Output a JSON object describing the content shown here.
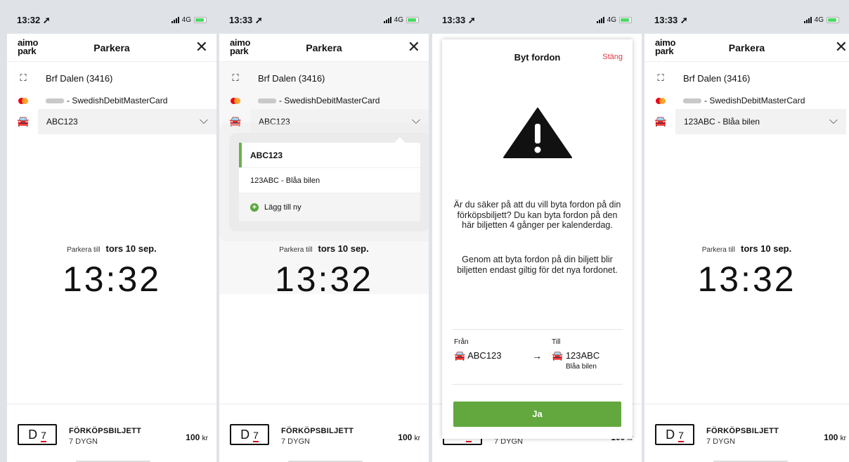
{
  "app": {
    "logo_line1": "aimo",
    "logo_line2": "park",
    "title": "Parkera"
  },
  "screens": [
    {
      "time": "13:32 ➚",
      "network": "4G",
      "location": "Brf Dalen (3416)",
      "card": "- SwedishDebitMasterCard",
      "vehicle": "ABC123",
      "parkera_till": "Parkera till",
      "date": "tors 10 sep.",
      "big_time": "13:32"
    },
    {
      "time": "13:33 ➚",
      "network": "4G",
      "location": "Brf Dalen (3416)",
      "card": "- SwedishDebitMasterCard",
      "vehicle": "ABC123",
      "parkera_till": "Parkera till",
      "date": "tors 10 sep.",
      "big_time": "13:32"
    },
    {
      "time": "13:33 ➚",
      "network": "4G"
    },
    {
      "time": "13:33 ➚",
      "network": "4G",
      "location": "Brf Dalen (3416)",
      "card": "- SwedishDebitMasterCard",
      "vehicle": "123ABC - Blåa bilen",
      "parkera_till": "Parkera till",
      "date": "tors 10 sep.",
      "big_time": "13:32"
    }
  ],
  "dropdown": {
    "items": [
      "ABC123",
      "123ABC - Blåa bilen"
    ],
    "add_label": "Lägg till ny"
  },
  "ticket": {
    "badge_letter": "D",
    "badge_num": "7",
    "title": "FÖRKÖPSBILJETT",
    "subtitle": "7 DYGN",
    "price": "100",
    "currency": "kr"
  },
  "modal": {
    "title": "Byt fordon",
    "close": "Stäng",
    "text1": "Är du säker på att du vill byta fordon på din förköpsbiljett? Du kan byta fordon på den här biljetten 4 gånger per kalenderdag.",
    "text2": "Genom att byta fordon på din biljett blir biljetten endast giltig för det nya fordonet.",
    "from_label": "Från",
    "to_label": "Till",
    "from_vehicle": "ABC123",
    "to_vehicle": "123ABC",
    "to_vehicle_name": "Blåa bilen",
    "confirm": "Ja"
  }
}
